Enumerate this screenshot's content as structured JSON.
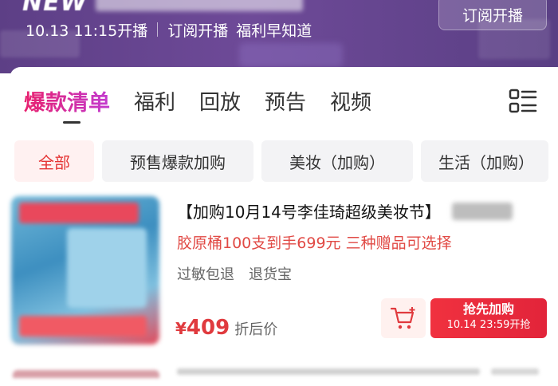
{
  "header": {
    "title_prefix": "NEW",
    "meta_date_time": "10.13 11:15开播",
    "meta_subscribe": "订阅开播",
    "meta_welfare": "福利早知道",
    "subscribe_button": "订阅开播",
    "background_color": "#6a4892"
  },
  "tabs": [
    {
      "label": "爆款清单",
      "active": true
    },
    {
      "label": "福利",
      "active": false
    },
    {
      "label": "回放",
      "active": false
    },
    {
      "label": "预告",
      "active": false
    },
    {
      "label": "视频",
      "active": false
    }
  ],
  "menu_icon": "list-grid-icon",
  "chips": [
    {
      "label": "全部",
      "active": true
    },
    {
      "label": "预售爆款加购",
      "active": false
    },
    {
      "label": "美妆（加购）",
      "active": false
    },
    {
      "label": "生活（加购）",
      "active": false
    }
  ],
  "product": {
    "title": "【加购10月14号李佳琦超级美妆节】",
    "description": "胶原桶100支到手699元 三种赠品可选择",
    "tags": [
      "过敏包退",
      "退货宝"
    ],
    "price_currency": "¥",
    "price_value": "409",
    "price_label": "折后价",
    "cart_icon": "cart-add-icon",
    "buy_button_line1": "抢先加购",
    "buy_button_line2": "10.14 23:59开抢"
  },
  "colors": {
    "accent_red": "#e03a3e",
    "tab_gradient_start": "#e8206e",
    "tab_gradient_end": "#c23bd0"
  }
}
